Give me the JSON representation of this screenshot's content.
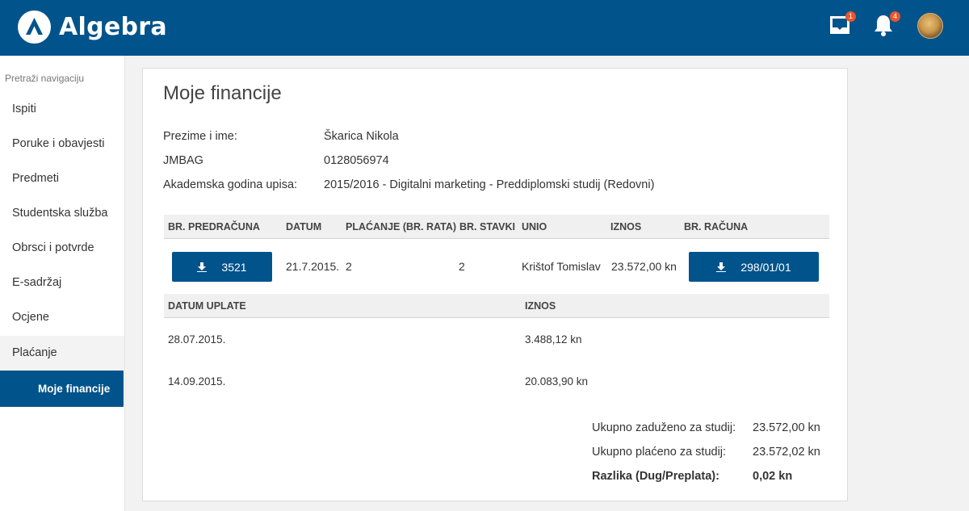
{
  "header": {
    "brand": "Algebra",
    "messages_badge": "1",
    "notifications_badge": "4"
  },
  "sidebar": {
    "search_placeholder": "Pretraži navigaciju",
    "items": [
      {
        "label": "Ispiti"
      },
      {
        "label": "Poruke i obavjesti"
      },
      {
        "label": "Predmeti"
      },
      {
        "label": "Studentska služba"
      },
      {
        "label": "Obrsci i potvrde"
      },
      {
        "label": "E-sadržaj"
      },
      {
        "label": "Ocjene"
      },
      {
        "label": "Plaćanje"
      }
    ],
    "active_sub": "Moje financije"
  },
  "main": {
    "title": "Moje financije",
    "info": [
      {
        "label": "Prezime i ime:",
        "value": "Škarica Nikola"
      },
      {
        "label": "JMBAG",
        "value": "0128056974"
      },
      {
        "label": "Akademska godina upisa:",
        "value": "2015/2016 - Digitalni marketing - Preddiplomski studij (Redovni)"
      }
    ],
    "invoice_table": {
      "headers": [
        "BR. PREDRAČUNA",
        "DATUM",
        "PLAĆANJE (BR. RATA)",
        "BR. STAVKI",
        "UNIO",
        "IZNOS",
        "BR. RAČUNA"
      ],
      "row": {
        "predracun": "3521",
        "datum": "21.7.2015.",
        "placanje": "2",
        "stavki": "2",
        "unio": "Krištof Tomislav",
        "iznos": "23.572,00 kn",
        "racun": "298/01/01"
      }
    },
    "payments_table": {
      "headers": [
        "DATUM UPLATE",
        "IZNOS"
      ],
      "rows": [
        {
          "date": "28.07.2015.",
          "amount": "3.488,12 kn"
        },
        {
          "date": "14.09.2015.",
          "amount": "20.083,90 kn"
        }
      ]
    },
    "summary": [
      {
        "label": "Ukupno zaduženo za studij:",
        "value": "23.572,00 kn"
      },
      {
        "label": "Ukupno plaćeno za studij:",
        "value": "23.572,02 kn"
      },
      {
        "label": "Razlika (Dug/Preplata):",
        "value": "0,02 kn"
      }
    ]
  }
}
